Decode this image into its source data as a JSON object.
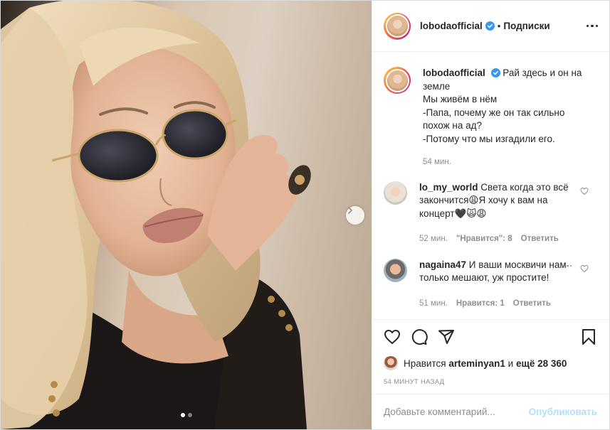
{
  "header": {
    "username": "lobodaofficial",
    "separator": "•",
    "follow_label": "Подписки"
  },
  "caption": {
    "username": "lobodaofficial",
    "lines": [
      "Рай здесь и он на",
      "земле",
      "Мы живём в нём",
      "-Папа, почему же он так сильно",
      "похож на ад?",
      "-Потому что мы изгадили его."
    ],
    "time": "54 мин."
  },
  "comments": [
    {
      "username": "lo_my_world",
      "text": "Света когда это всё закончится😩Я хочу к вам на концерт🖤🙀😩",
      "time": "52 мин.",
      "likes": "\"Нравится\": 8",
      "reply": "Ответить"
    },
    {
      "username": "nagaina47",
      "text": "И ваши москвичи нам только мешают, уж простите!",
      "time": "51 мин.",
      "likes": "Нравится: 1",
      "reply": "Ответить"
    }
  ],
  "likes": {
    "prefix": "Нравится",
    "user": "arteminyan1",
    "middle": "и",
    "rest": "ещё 28 360"
  },
  "timestamp": "54 МИНУТ НАЗАД",
  "add_comment": {
    "placeholder": "Добавьте комментарий...",
    "publish_label": "Опубликовать"
  },
  "carousel": {
    "current": 1,
    "total": 2
  },
  "icons": {
    "like": "heart-icon",
    "comment": "comment-icon",
    "share": "share-icon",
    "save": "bookmark-icon",
    "verified": "verified-badge-icon",
    "next": "chevron-right-icon",
    "more": "more-options-icon"
  },
  "colors": {
    "verified": "#3897f0",
    "publish_disabled": "#b2dffc",
    "muted_text": "#8e8e8e"
  }
}
